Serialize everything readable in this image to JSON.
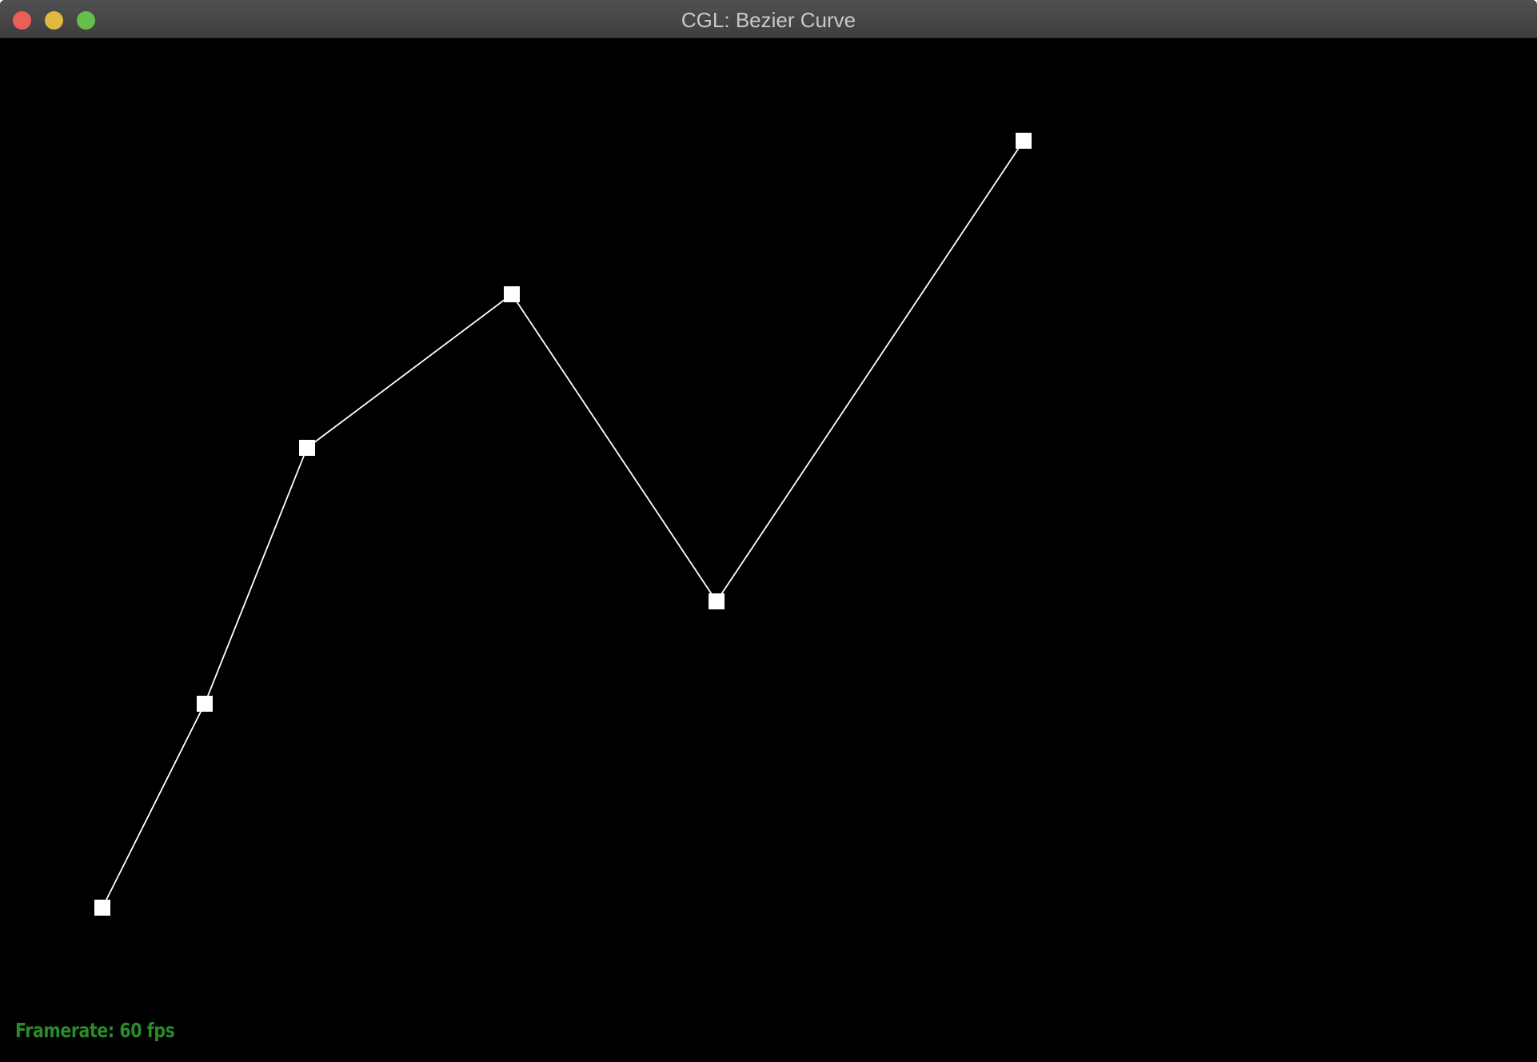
{
  "window": {
    "title": "CGL: Bezier Curve"
  },
  "status": {
    "framerate_label": "Framerate: 60 fps"
  },
  "colors": {
    "background": "#000000",
    "line": "#ffffff",
    "point": "#ffffff",
    "status_text": "#2b8a2b"
  }
}
